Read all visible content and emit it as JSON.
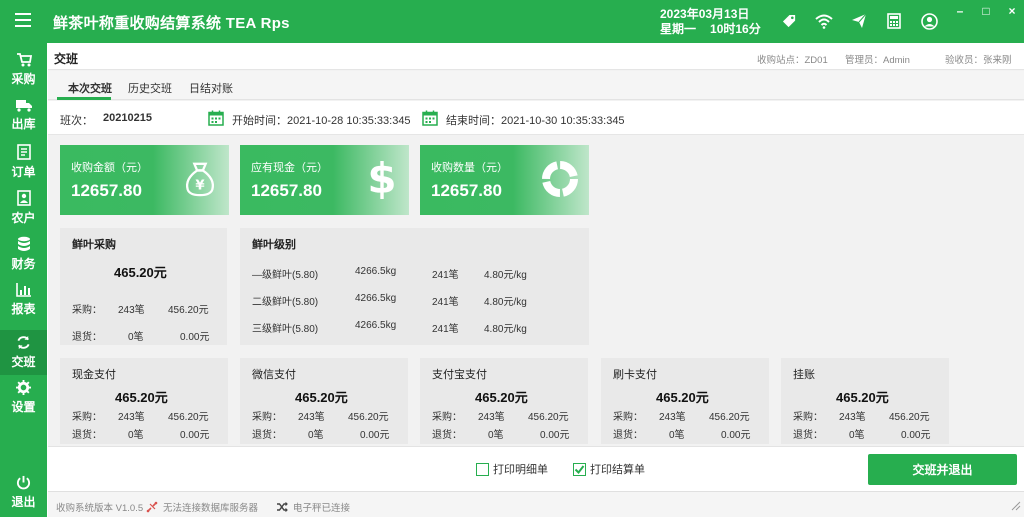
{
  "app": {
    "title": "鲜茶叶称重收购结算系统  TEA  Rps"
  },
  "datetime": {
    "date": "2023年03月13日",
    "weekday": "星期一",
    "time": "10时16分"
  },
  "window": {
    "minimize": "–",
    "maximize": "□",
    "close": "×"
  },
  "icons": [
    "tag-icon",
    "wifi-icon",
    "send-icon",
    "calculator-icon",
    "user-icon"
  ],
  "nav": [
    {
      "label": "采购",
      "icon": "cart-icon"
    },
    {
      "label": "出库",
      "icon": "truck-icon"
    },
    {
      "label": "订单",
      "icon": "order-icon"
    },
    {
      "label": "农户",
      "icon": "farmer-icon"
    },
    {
      "label": "财务",
      "icon": "database-icon"
    },
    {
      "label": "报表",
      "icon": "chart-icon"
    },
    {
      "label": "交班",
      "icon": "refresh-icon",
      "active": true
    },
    {
      "label": "设置",
      "icon": "gear-icon"
    }
  ],
  "nav_logout": "退出",
  "page": {
    "title": "交班",
    "station": "收购站点：ZD01",
    "admin": "管理员：Admin",
    "inspector": "验收员：张来刚"
  },
  "tabs": [
    "本次交班",
    "历史交班",
    "日结对账"
  ],
  "shift": {
    "label": "班次：",
    "number": "20210215",
    "start": "开始时间：2021-10-28 10:35:33:345",
    "end": "结束时间：2021-10-30 10:35:33:345"
  },
  "stats": [
    {
      "title": "收购金额（元）",
      "value": "12657.80",
      "icon": "money-bag-icon"
    },
    {
      "title": "应有现金（元）",
      "value": "12657.80",
      "icon": "dollar-icon"
    },
    {
      "title": "收购数量（元）",
      "value": "12657.80",
      "icon": "donut-icon"
    }
  ],
  "fresh_purchase": {
    "title": "鲜叶采购",
    "amount": "465.20元",
    "buy_label": "采购：",
    "buy_count": "243笔",
    "buy_amount": "456.20元",
    "return_label": "退货：",
    "return_count": "0笔",
    "return_amount": "0.00元"
  },
  "grade": {
    "title": "鲜叶级别",
    "rows": [
      {
        "name": "—级鲜叶(5.80)",
        "weight": "4266.5kg",
        "count": "241笔",
        "price": "4.80元/kg"
      },
      {
        "name": "二级鲜叶(5.80)",
        "weight": "4266.5kg",
        "count": "241笔",
        "price": "4.80元/kg"
      },
      {
        "name": "三级鲜叶(5.80)",
        "weight": "4266.5kg",
        "count": "241笔",
        "price": "4.80元/kg"
      }
    ]
  },
  "payments": [
    {
      "title": "现金支付",
      "amount": "465.20元",
      "buy_label": "采购：",
      "buy_count": "243笔",
      "buy_amount": "456.20元",
      "return_label": "退货：",
      "return_count": "0笔",
      "return_amount": "0.00元"
    },
    {
      "title": "微信支付",
      "amount": "465.20元",
      "buy_label": "采购：",
      "buy_count": "243笔",
      "buy_amount": "456.20元",
      "return_label": "退货：",
      "return_count": "0笔",
      "return_amount": "0.00元"
    },
    {
      "title": "支付宝支付",
      "amount": "465.20元",
      "buy_label": "采购：",
      "buy_count": "243笔",
      "buy_amount": "456.20元",
      "return_label": "退货：",
      "return_count": "0笔",
      "return_amount": "0.00元"
    },
    {
      "title": "刷卡支付",
      "amount": "465.20元",
      "buy_label": "采购：",
      "buy_count": "243笔",
      "buy_amount": "456.20元",
      "return_label": "退货：",
      "return_count": "0笔",
      "return_amount": "0.00元"
    },
    {
      "title": "挂账",
      "amount": "465.20元",
      "buy_label": "采购：",
      "buy_count": "243笔",
      "buy_amount": "456.20元",
      "return_label": "退货：",
      "return_count": "0笔",
      "return_amount": "0.00元"
    }
  ],
  "footer": {
    "print_detail": "打印明细单",
    "print_detail_checked": false,
    "print_settle": "打印结算单",
    "print_settle_checked": true,
    "submit": "交班并退出"
  },
  "status": {
    "version": "收购系统版本 V1.0.5",
    "db": "无法连接数据库服务器",
    "scale": "电子秤已连接"
  },
  "colors": {
    "brand": "#27ae4f",
    "brand_dark": "#1f9442"
  }
}
